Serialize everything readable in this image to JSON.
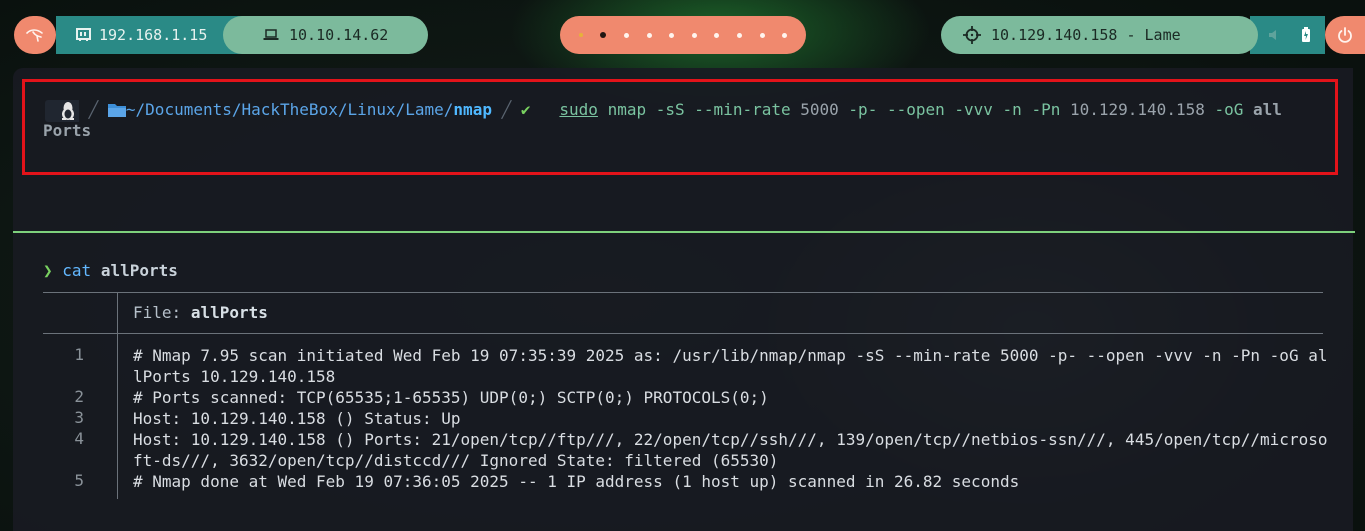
{
  "topbar": {
    "local_ip": "192.168.1.15",
    "vpn_ip": "10.10.14.62",
    "target": "10.129.140.158 - Lame",
    "workspace_count": 10,
    "active_workspace": 2,
    "icons": {
      "menu": "kali-dragon-icon",
      "local": "network-card-icon",
      "vpn": "laptop-icon",
      "target": "crosshair-icon",
      "power": "power-icon",
      "battery": "battery-icon"
    },
    "colors": {
      "coral": "#f0896e",
      "teal": "#2a8a86",
      "green": "#7cba9c"
    }
  },
  "prompt": {
    "path_prefix": "~/Documents/HackTheBox/Linux/Lame/",
    "path_dir": "nmap",
    "status": "✔",
    "cmd_sudo": "sudo",
    "cmd_nmap": "nmap",
    "args_1": "-sS --min-rate",
    "rate": "5000",
    "args_2": "-p- --open -vvv -n -Pn",
    "target_ip": "10.129.140.158",
    "args_3": "-oG",
    "out_file_1": "all",
    "out_file_2": "Ports"
  },
  "cat_command": {
    "arrow": "❯",
    "cmd": "cat",
    "arg": "allPorts"
  },
  "bat": {
    "file_label": "File:",
    "file_name": "allPorts",
    "lines": [
      {
        "no": "1",
        "text": "# Nmap 7.95 scan initiated Wed Feb 19 07:35:39 2025 as: /usr/lib/nmap/nmap -sS --min-rate 5000 -p- --open -vvv -n -Pn -oG allPorts 10.129.140.158"
      },
      {
        "no": "2",
        "text": "# Ports scanned: TCP(65535;1-65535) UDP(0;) SCTP(0;) PROTOCOLS(0;)"
      },
      {
        "no": "3",
        "text": "Host: 10.129.140.158 () Status: Up"
      },
      {
        "no": "4",
        "text": "Host: 10.129.140.158 () Ports: 21/open/tcp//ftp///, 22/open/tcp//ssh///, 139/open/tcp//netbios-ssn///, 445/open/tcp//microsoft-ds///, 3632/open/tcp//distccd/// Ignored State: filtered (65530)"
      },
      {
        "no": "5",
        "text": "# Nmap done at Wed Feb 19 07:36:05 2025 -- 1 IP address (1 host up) scanned in 26.82 seconds"
      }
    ]
  }
}
